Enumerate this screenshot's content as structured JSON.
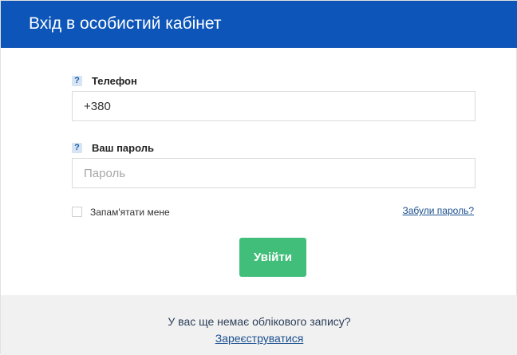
{
  "header": {
    "title": "Вхід в особистий кабінет"
  },
  "form": {
    "phone": {
      "help_icon": "?",
      "label": "Телефон",
      "value": "+380",
      "placeholder": ""
    },
    "password": {
      "help_icon": "?",
      "label": "Ваш пароль",
      "value": "",
      "placeholder": "Пароль"
    },
    "remember_label": "Запам'ятати мене",
    "remember_checked": false,
    "forgot_link": "Забули пароль?",
    "submit_label": "Увійти"
  },
  "footer": {
    "no_account_text": "У вас ще немає облікового запису?",
    "register_link": "Зареєструватися"
  },
  "colors": {
    "header_bg": "#0d55b8",
    "submit_bg": "#41be79",
    "link": "#1a4f8f",
    "footer_bg": "#f1f1f1"
  }
}
